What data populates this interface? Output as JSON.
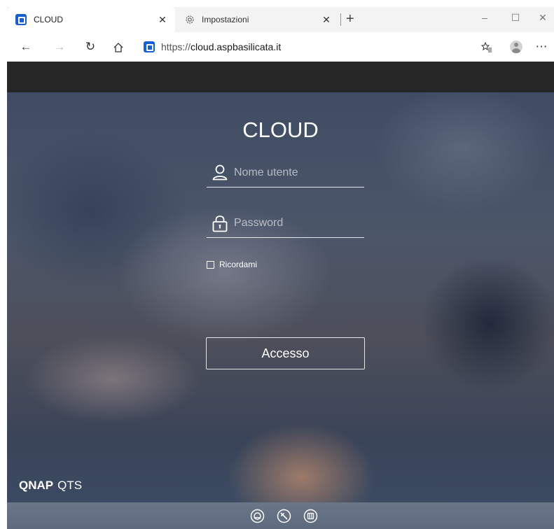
{
  "browser": {
    "tabs": [
      {
        "title": "CLOUD",
        "active": true,
        "icon": "qnap-favicon-icon"
      },
      {
        "title": "Impostazioni",
        "active": false,
        "icon": "gear-icon"
      }
    ],
    "url_scheme": "https://",
    "url_host": "cloud.aspbasilicata.it"
  },
  "login": {
    "title": "CLOUD",
    "username_placeholder": "Nome utente",
    "password_placeholder": "Password",
    "remember_label": "Ricordami",
    "remember_checked": false,
    "submit_label": "Accesso"
  },
  "brand": {
    "primary": "QNAP",
    "secondary": "QTS"
  },
  "footer_icons": [
    "qfinder-icon",
    "tools-icon",
    "app-center-icon"
  ],
  "colors": {
    "top_band": "#262626",
    "accent_favicon": "#1a5fd1",
    "text": "#ffffff"
  }
}
